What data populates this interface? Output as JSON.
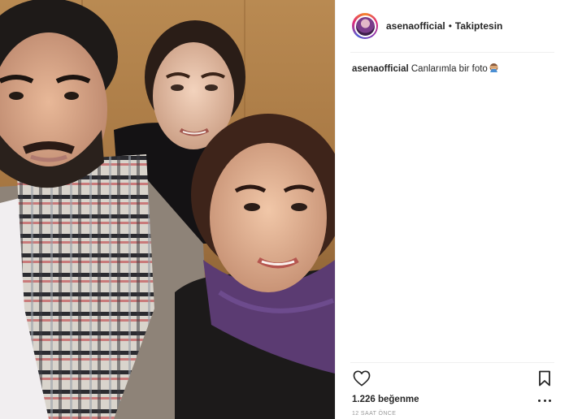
{
  "post": {
    "username": "asenaofficial",
    "separator": "•",
    "follow_status": "Takiptesin",
    "caption_user": "asenaofficial",
    "caption_text": "Canlarımla bir foto",
    "likes_text": "1.226 beğenme",
    "time_text": "12 SAAT ÖNCE"
  },
  "icons": {
    "like": "heart-icon",
    "save": "bookmark-icon",
    "more": "more-options-icon",
    "caption_emoji": "see-no-evil-monkey-icon"
  },
  "colors": {
    "text": "#262626",
    "muted": "#999999",
    "divider": "#efefef"
  }
}
